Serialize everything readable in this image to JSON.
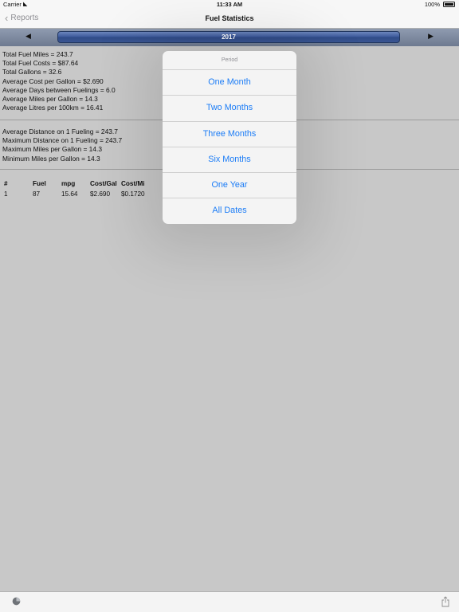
{
  "status_bar": {
    "carrier": "Carrier",
    "time": "11:33 AM",
    "battery": "100%"
  },
  "nav": {
    "back_label": "Reports",
    "title": "Fuel Statistics"
  },
  "year_bar": {
    "year": "2017",
    "prev_icon": "◀",
    "next_icon": "▶"
  },
  "stats_group1": [
    "Total Fuel Miles = 243.7",
    "Total Fuel Costs = $87.64",
    "Total Gallons = 32.6",
    "Average Cost per Gallon = $2.690",
    "Average Days between Fuelings = 6.0",
    "Average Miles per Gallon = 14.3",
    "Average Litres per 100km = 16.41"
  ],
  "stats_group2": [
    "Average Distance on 1 Fueling = 243.7",
    "Maximum Distance on 1 Fueling = 243.7",
    "Maximum Miles per Gallon = 14.3",
    "Minimum Miles per Gallon = 14.3"
  ],
  "table": {
    "headers": [
      "#",
      "Fuel",
      "mpg",
      "Cost/Gal",
      "Cost/Mi"
    ],
    "rows": [
      [
        "1",
        "87",
        "15.64",
        "$2.690",
        "$0.1720"
      ]
    ]
  },
  "popover": {
    "title": "Period",
    "options": [
      "One Month",
      "Two Months",
      "Three Months",
      "Six Months",
      "One Year",
      "All Dates"
    ]
  },
  "toolbar": {
    "left_icon": "pie-chart-icon",
    "right_icon": "share-icon"
  },
  "colors": {
    "accent": "#1b7cf6",
    "year_pill": "#3b589a",
    "background": "#c8c8c8"
  }
}
